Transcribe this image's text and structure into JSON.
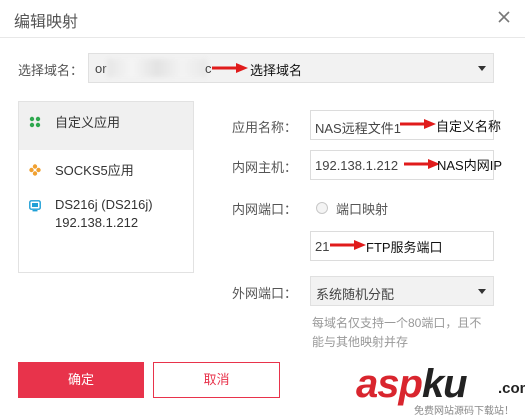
{
  "dialog": {
    "title": "编辑映射",
    "close_icon": "close-icon"
  },
  "domain": {
    "label": "选择域名：",
    "value_prefix": "or",
    "value_suffix": "c",
    "annotation": "选择域名"
  },
  "app_list": {
    "items": [
      {
        "label": "自定义应用",
        "icon": "custom-app-icon",
        "color": "#2fa84f",
        "active": true
      },
      {
        "label": "SOCKS5应用",
        "icon": "socks5-icon",
        "color": "#f0a030",
        "active": false
      },
      {
        "label": "DS216j (DS216j)",
        "sublabel": "192.138.1.212",
        "icon": "device-icon",
        "color": "#1e9fd6",
        "active": false
      }
    ]
  },
  "form": {
    "app_name": {
      "label": "应用名称：",
      "value": "NAS远程文件1",
      "annotation": "自定义名称"
    },
    "internal_host": {
      "label": "内网主机：",
      "value": "192.138.1.212",
      "annotation": "NAS内网IP"
    },
    "internal_port": {
      "label": "内网端口：",
      "radio_label": "端口映射",
      "value": "21",
      "annotation": "FTP服务端口"
    },
    "external_port": {
      "label": "外网端口：",
      "selected": "系统随机分配",
      "hint_line1": "每域名仅支持一个80端口，且不",
      "hint_line2": "能与其他映射并存"
    }
  },
  "buttons": {
    "confirm": "确定",
    "cancel": "取消"
  },
  "watermark": {
    "brand_a": "asp",
    "brand_b": "ku",
    "brand_c": ".com",
    "sub": "免费网站源码下载站！"
  },
  "colors": {
    "accent": "#e8334b",
    "arrow": "#e01b1b"
  }
}
